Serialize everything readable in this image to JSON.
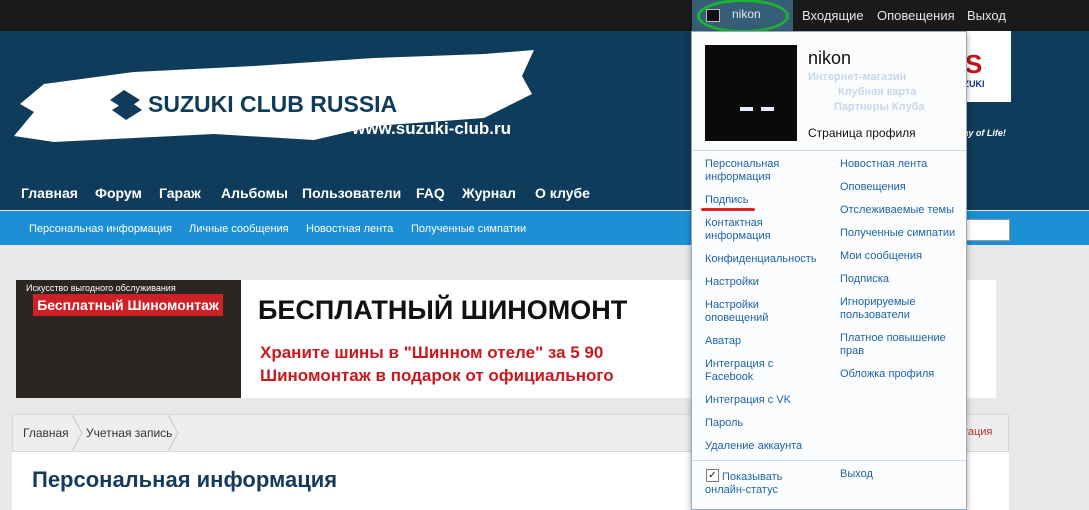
{
  "topbar": {
    "username": "nikon",
    "links": [
      "Входящие",
      "Оповещения",
      "Выход"
    ]
  },
  "header": {
    "banner_title": "SUZUKI CLUB RUSSIA",
    "banner_url": "www.suzuki-club.ru",
    "brand_logo": "SUZUKI",
    "slogan": "Way of Life!",
    "nav": [
      "Главная",
      "Форум",
      "Гараж",
      "Альбомы",
      "Пользователи",
      "FAQ",
      "Журнал",
      "О клубе"
    ],
    "subnav": [
      "Персональная информация",
      "Личные сообщения",
      "Новостная лента",
      "Полученные симпатии"
    ]
  },
  "ad": {
    "left_top": "Искусство выгодного обслуживания",
    "left_badge": "Бесплатный Шиномонтаж",
    "title": "БЕСПЛАТНЫЙ ШИНОМОНТ",
    "line1": "Храните шины в \"Шинном отеле\" за 5 90",
    "line2": "Шиномонтаж в подарок от официального"
  },
  "breadcrumb": {
    "items": [
      "Главная",
      "Учетная запись"
    ],
    "quick_nav": "Быстрая навигация"
  },
  "page": {
    "title": "Персональная информация"
  },
  "menu": {
    "username": "nikon",
    "ghost_links": [
      "Интернет-магазин",
      "Клубная карта",
      "Партнеры Клуба"
    ],
    "profile_link": "Страница профиля",
    "left": [
      "Персональная информация",
      "Подпись",
      "Контактная информация",
      "Конфиденциальность",
      "Настройки",
      "Настройки оповещений",
      "Аватар",
      "Интеграция с Facebook",
      "Интеграция с VK",
      "Пароль",
      "Удаление аккаунта"
    ],
    "right": [
      "Новостная лента",
      "Оповещения",
      "Отслеживаемые темы",
      "Полученные симпатии",
      "Мои сообщения",
      "Подписка",
      "Игнорируемые пользователи",
      "Платное повышение прав",
      "Обложка профиля"
    ],
    "show_online": "Показывать онлайн-статус",
    "logout": "Выход",
    "checkbox_checked": true
  },
  "colors": {
    "topbar": "#1a1a1a",
    "header": "#0f3c5a",
    "subnav": "#1d8fd4",
    "link": "#1e63a5",
    "highlight": "#1db333"
  }
}
